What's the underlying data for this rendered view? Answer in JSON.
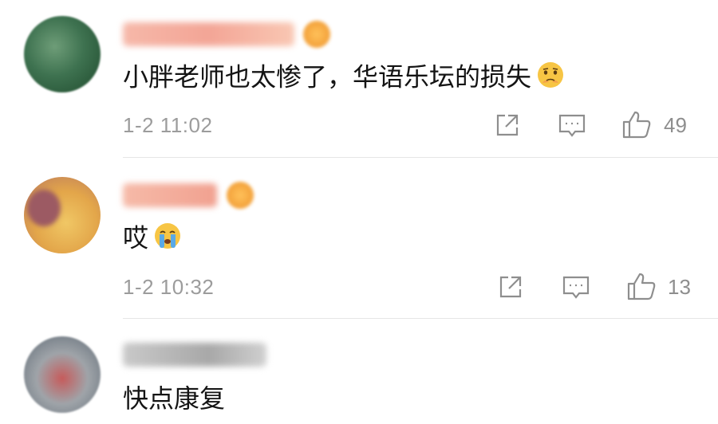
{
  "comments": [
    {
      "username": "",
      "text": "小胖老师也太惨了，华语乐坛的损失",
      "emoji": "worried-face",
      "time": "1-2 11:02",
      "likes": "49"
    },
    {
      "username": "",
      "text": "哎",
      "emoji": "crying-face",
      "time": "1-2 10:32",
      "likes": "13"
    },
    {
      "username": "",
      "text": "快点康复"
    }
  ],
  "icons": {
    "share": "share-icon",
    "reply": "comment-icon",
    "like": "thumbs-up-icon"
  },
  "colors": {
    "text": "#141414",
    "meta": "#9c9c9c",
    "divider": "#e6e6e6"
  }
}
